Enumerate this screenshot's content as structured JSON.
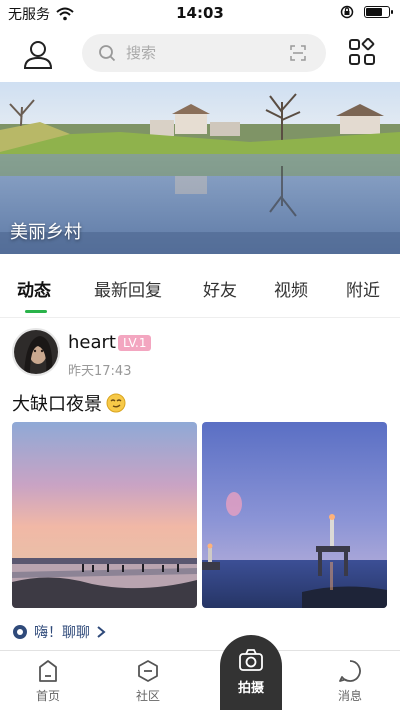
{
  "status_bar": {
    "carrier": "无服务",
    "time": "14:03",
    "battery_level": 0.75
  },
  "top_nav": {
    "search_placeholder": "搜索",
    "icons": [
      "person-icon",
      "search-icon",
      "scan-icon",
      "apps-grid-icon"
    ]
  },
  "banner": {
    "title": "美丽乡村"
  },
  "tabs": [
    {
      "label": "动态",
      "active": true
    },
    {
      "label": "最新回复",
      "active": false
    },
    {
      "label": "好友",
      "active": false
    },
    {
      "label": "视频",
      "active": false
    },
    {
      "label": "附近",
      "active": false
    }
  ],
  "post": {
    "username": "heart",
    "level": "LV.1",
    "time": "昨天17:43",
    "text": "大缺口夜景",
    "tag": "嗨！聊聊"
  },
  "bottom_nav": {
    "items": [
      {
        "label": "首页"
      },
      {
        "label": "社区"
      },
      {
        "label": "拍摄"
      },
      {
        "label": "消息"
      }
    ]
  },
  "colors": {
    "accent": "#2ab34a",
    "level_badge": "#f3a6c0",
    "camera_fab": "#333333",
    "tag_text": "#2f4a7a"
  }
}
